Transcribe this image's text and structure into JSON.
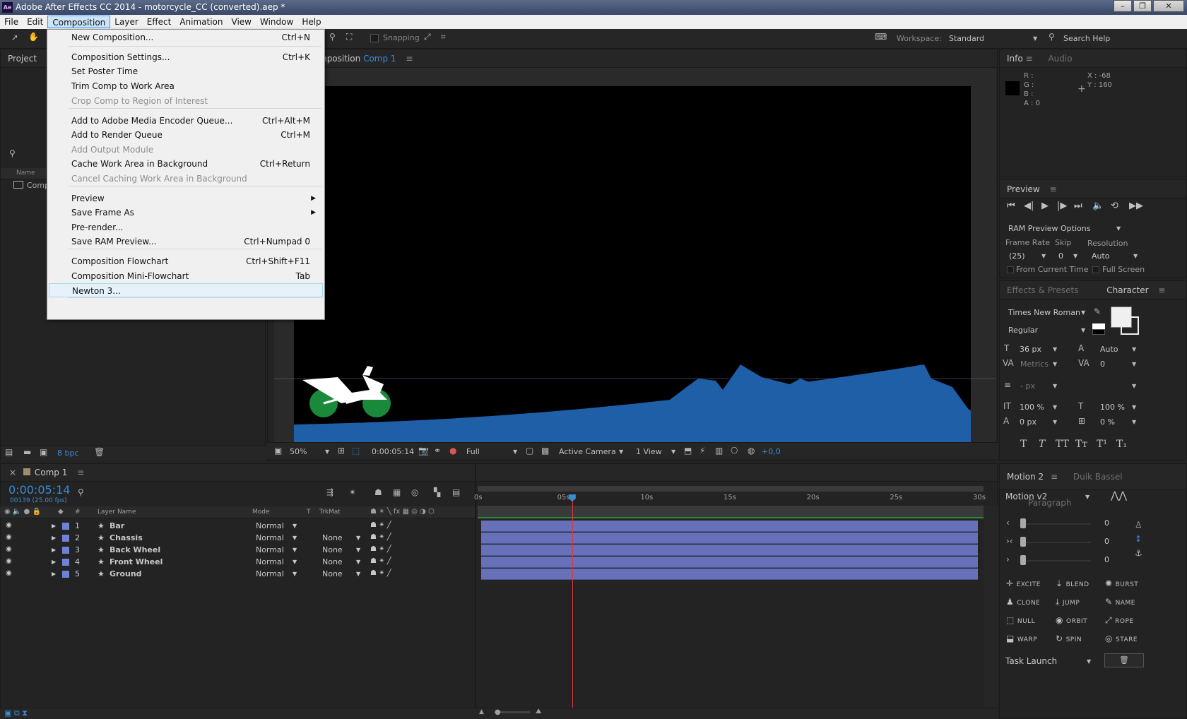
{
  "window": {
    "title": "Adobe After Effects CC 2014 - motorcycle_CC (converted).aep *",
    "logo": "Ae"
  },
  "menubar": [
    "File",
    "Edit",
    "Composition",
    "Layer",
    "Effect",
    "Animation",
    "View",
    "Window",
    "Help"
  ],
  "toolbar": {
    "snapping": "Snapping",
    "workspace_label": "Workspace:",
    "workspace_value": "Standard",
    "search_help": "Search Help"
  },
  "composition_menu": [
    {
      "label": "New Composition...",
      "shortcut": "Ctrl+N"
    },
    {
      "label": "Composition Settings...",
      "shortcut": "Ctrl+K"
    },
    {
      "label": "Set Poster Time",
      "shortcut": ""
    },
    {
      "label": "Trim Comp to Work Area",
      "shortcut": ""
    },
    {
      "label": "Crop Comp to Region of Interest",
      "shortcut": "",
      "disabled": true
    },
    {
      "label": "Add to Adobe Media Encoder Queue...",
      "shortcut": "Ctrl+Alt+M"
    },
    {
      "label": "Add to Render Queue",
      "shortcut": "Ctrl+M"
    },
    {
      "label": "Add Output Module",
      "shortcut": "",
      "disabled": true
    },
    {
      "label": "Cache Work Area in Background",
      "shortcut": "Ctrl+Return"
    },
    {
      "label": "Cancel Caching Work Area in Background",
      "shortcut": "",
      "disabled": true
    },
    {
      "label": "Preview",
      "shortcut": ""
    },
    {
      "label": "Save Frame As",
      "shortcut": ""
    },
    {
      "label": "Pre-render...",
      "shortcut": ""
    },
    {
      "label": "Save RAM Preview...",
      "shortcut": "Ctrl+Numpad 0"
    },
    {
      "label": "Composition Flowchart",
      "shortcut": "Ctrl+Shift+F11"
    },
    {
      "label": "Composition Mini-Flowchart",
      "shortcut": "Tab"
    },
    {
      "label": "Newton 3...",
      "shortcut": ""
    }
  ],
  "project": {
    "title": "Project",
    "name_col": "Name",
    "item": "Comp",
    "bpc": "8 bpc"
  },
  "comp_panel": {
    "tab_prefix": "mposition",
    "tab_name": "Comp 1"
  },
  "viewer_bar": {
    "zoom": "50%",
    "timecode": "0:00:05:14",
    "resolution": "Full",
    "camera": "Active Camera",
    "views": "1 View",
    "exposure": "+0,0"
  },
  "info": {
    "tab": "Info",
    "tab2": "Audio",
    "r": "R :",
    "g": "G :",
    "b": "B :",
    "a": "A : 0",
    "x": "X : -68",
    "y": "Y : 160"
  },
  "preview": {
    "title": "Preview",
    "ram_options": "RAM Preview Options",
    "frame_rate_label": "Frame Rate",
    "frame_rate": "(25)",
    "skip_label": "Skip",
    "skip": "0",
    "resolution_label": "Resolution",
    "resolution": "Auto",
    "from_current": "From Current Time",
    "full_screen": "Full Screen"
  },
  "character": {
    "tab1": "Effects & Presets",
    "tab2": "Character",
    "font": "Times New Roman",
    "style": "Regular",
    "size": "36 px",
    "leading": "Auto",
    "kerning": "Metrics",
    "tracking": "0",
    "stroke": "- px",
    "vscale": "100 %",
    "hscale": "100 %",
    "baseline": "0 px",
    "tsume": "0 %",
    "style_buttons": [
      "T",
      "T",
      "TT",
      "Tт",
      "T¹",
      "T₁"
    ]
  },
  "timeline": {
    "tab": "Comp 1",
    "timecode": "0:00:05:14",
    "frames": "00139 (25.00 fps)",
    "col_layer": "Layer Name",
    "col_mode": "Mode",
    "col_t": "T",
    "col_trkmat": "TrkMat",
    "col_num": "#",
    "ticks": [
      "0s",
      "05s",
      "10s",
      "15s",
      "20s",
      "25s",
      "30s"
    ],
    "playhead": 5.56,
    "duration": 30
  },
  "layers": [
    {
      "num": "1",
      "name": "Bar",
      "mode": "Normal",
      "trkmat": ""
    },
    {
      "num": "2",
      "name": "Chassis",
      "mode": "Normal",
      "trkmat": "None"
    },
    {
      "num": "3",
      "name": "Back Wheel",
      "mode": "Normal",
      "trkmat": "None"
    },
    {
      "num": "4",
      "name": "Front Wheel",
      "mode": "Normal",
      "trkmat": "None"
    },
    {
      "num": "5",
      "name": "Ground",
      "mode": "Normal",
      "trkmat": "None"
    }
  ],
  "motion": {
    "tab1": "Motion 2",
    "tab2": "Duik Bassel",
    "tab3": "Paragraph",
    "preset": "Motion v2",
    "slider_values": [
      "0",
      "0",
      "0"
    ],
    "buttons": [
      "EXCITE",
      "BLEND",
      "BURST",
      "CLONE",
      "JUMP",
      "NAME",
      "NULL",
      "ORBIT",
      "ROPE",
      "WARP",
      "SPIN",
      "STARE"
    ],
    "task": "Task Launch"
  },
  "colors": {
    "ground": "#1f5fa8",
    "wheel": "#1a8a3a",
    "layer_bar": "#6771b9",
    "playhead": "#d43a3a",
    "accent": "#3a8bd6"
  }
}
